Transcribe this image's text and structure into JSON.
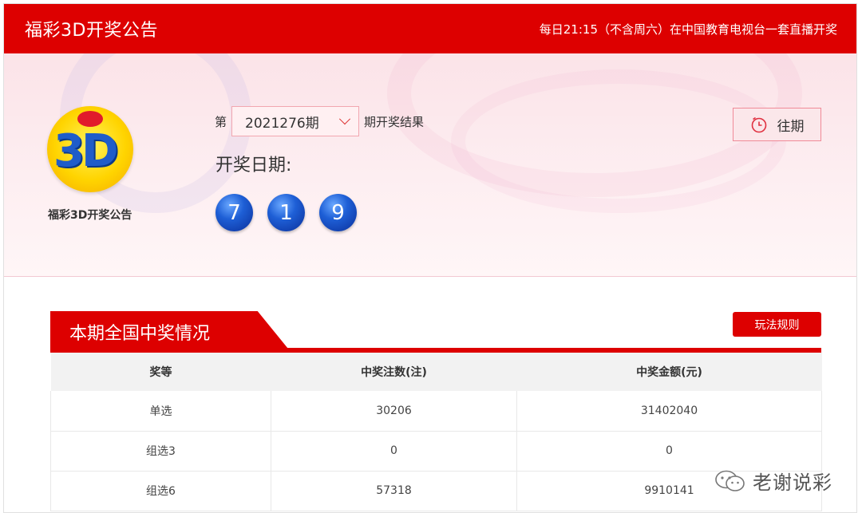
{
  "header": {
    "title": "福彩3D开奖公告",
    "schedule": "每日21:15（不含周六）在中国教育电视台一套直播开奖"
  },
  "logo": {
    "caption": "福彩3D开奖公告"
  },
  "issue": {
    "prefix": "第",
    "selected": "2021276期",
    "suffix": "期开奖结果"
  },
  "draw_date_label": "开奖日期:",
  "balls": [
    "7",
    "1",
    "9"
  ],
  "history_button": "往期",
  "section": {
    "title": "本期全国中奖情况",
    "rules_button": "玩法规则"
  },
  "table": {
    "headers": [
      "奖等",
      "中奖注数(注)",
      "中奖金额(元)"
    ],
    "rows": [
      [
        "单选",
        "30206",
        "31402040"
      ],
      [
        "组选3",
        "0",
        "0"
      ],
      [
        "组选6",
        "57318",
        "9910141"
      ]
    ]
  },
  "watermark": "老谢说彩",
  "colors": {
    "brand_red": "#dd0000",
    "ball_blue": "#1e5fd6"
  },
  "icons": {
    "history": "clock-icon",
    "dropdown": "chevron-down-icon",
    "watermark": "wechat-icon"
  }
}
